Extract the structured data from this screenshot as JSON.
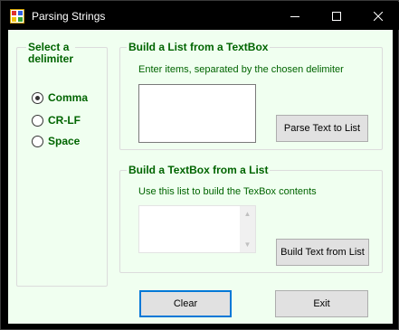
{
  "window": {
    "title": "Parsing Strings"
  },
  "caption_buttons": [
    "minimize",
    "maximize",
    "close"
  ],
  "delimiter_group": {
    "legend_line1": "Select a",
    "legend_line2": "delimiter",
    "options": [
      {
        "label": "Comma",
        "checked": true
      },
      {
        "label": "CR-LF",
        "checked": false
      },
      {
        "label": "Space",
        "checked": false
      }
    ]
  },
  "textbox_group": {
    "legend": "Build a List from a TextBox",
    "hint": "Enter items, separated by the chosen delimiter",
    "textbox_value": "",
    "button_label": "Parse Text to List"
  },
  "list_group": {
    "legend": "Build a TextBox from a List",
    "hint": "Use this list to build the TexBox contents",
    "list_items": [],
    "button_label": "Build Text from List"
  },
  "footer": {
    "clear_label": "Clear",
    "exit_label": "Exit"
  },
  "colors": {
    "form_background": "#f0fff0",
    "label_text": "#006400",
    "title_bar": "#000000",
    "default_button_border": "#0078d7"
  }
}
